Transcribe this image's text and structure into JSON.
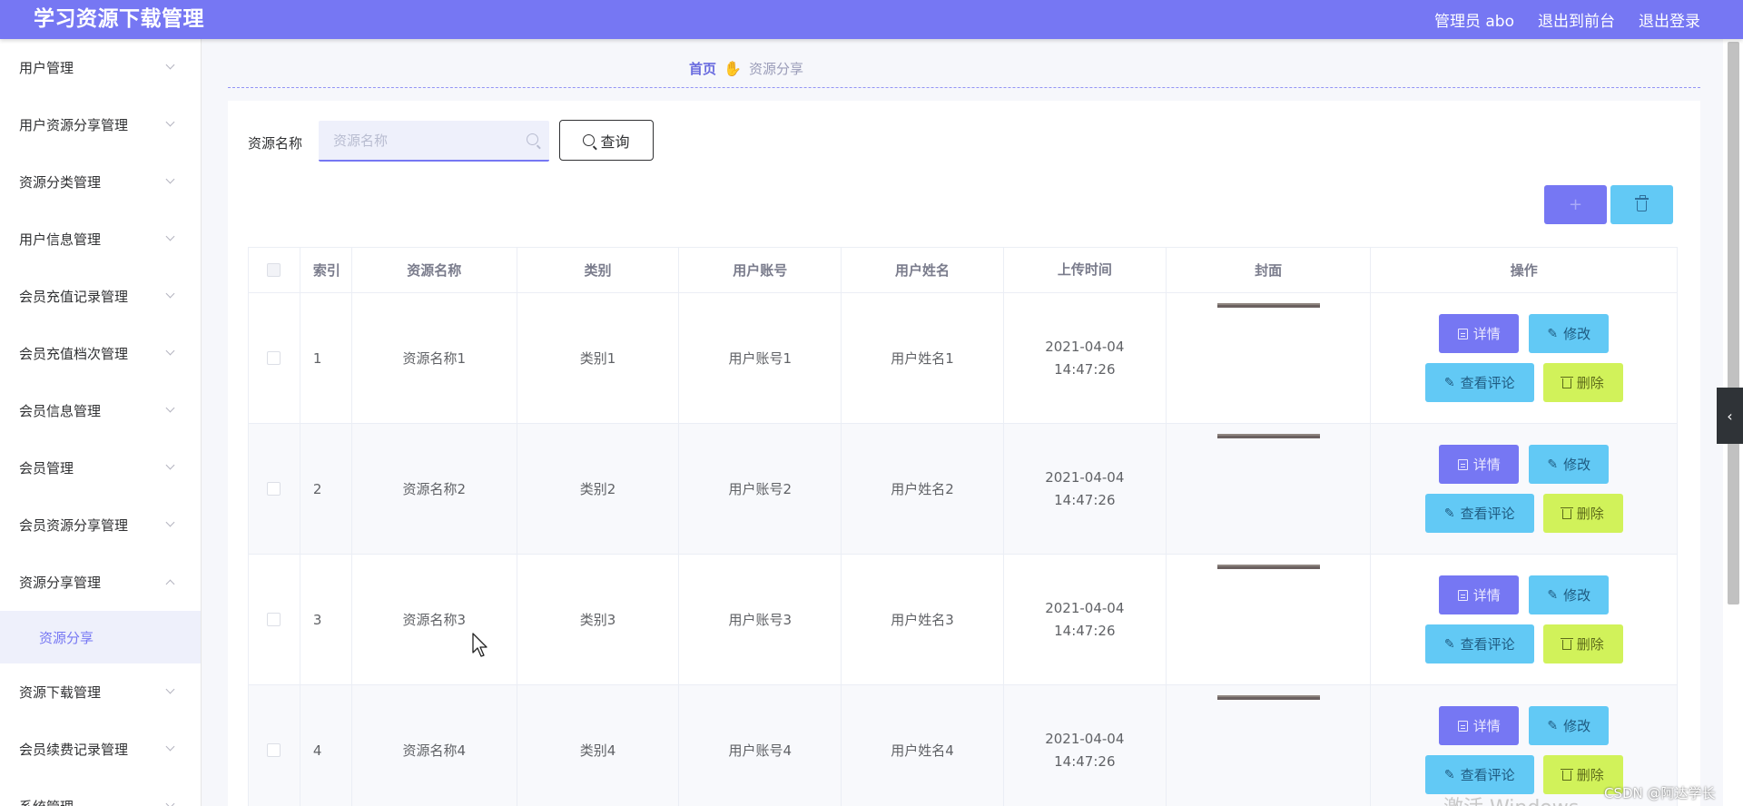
{
  "header": {
    "title": "学习资源下载管理",
    "admin": "管理员 abo",
    "to_front": "退出到前台",
    "logout": "退出登录"
  },
  "sidebar": {
    "items": [
      {
        "label": "用户管理",
        "open": false
      },
      {
        "label": "用户资源分享管理",
        "open": false
      },
      {
        "label": "资源分类管理",
        "open": false
      },
      {
        "label": "用户信息管理",
        "open": false
      },
      {
        "label": "会员充值记录管理",
        "open": false
      },
      {
        "label": "会员充值档次管理",
        "open": false
      },
      {
        "label": "会员信息管理",
        "open": false
      },
      {
        "label": "会员管理",
        "open": false
      },
      {
        "label": "会员资源分享管理",
        "open": false
      },
      {
        "label": "资源分享管理",
        "open": true
      }
    ],
    "active_sub": "资源分享",
    "items_after": [
      {
        "label": "资源下载管理"
      },
      {
        "label": "会员续费记录管理"
      },
      {
        "label": "系统管理"
      }
    ]
  },
  "breadcrumb": {
    "home": "首页",
    "current": "资源分享"
  },
  "search": {
    "label": "资源名称",
    "placeholder": "资源名称",
    "value": "",
    "button": "查询"
  },
  "toolbar": {
    "add_icon": "plus-icon",
    "delete_icon": "trash-icon"
  },
  "table": {
    "headers": [
      "索引",
      "资源名称",
      "类别",
      "用户账号",
      "用户姓名",
      "上传时间",
      "封面",
      "操作"
    ],
    "rows": [
      {
        "index": "1",
        "name": "资源名称1",
        "category": "类别1",
        "account": "用户账号1",
        "username": "用户姓名1",
        "time": "2021-04-04 14:47:26"
      },
      {
        "index": "2",
        "name": "资源名称2",
        "category": "类别2",
        "account": "用户账号2",
        "username": "用户姓名2",
        "time": "2021-04-04 14:47:26"
      },
      {
        "index": "3",
        "name": "资源名称3",
        "category": "类别3",
        "account": "用户账号3",
        "username": "用户姓名3",
        "time": "2021-04-04 14:47:26"
      },
      {
        "index": "4",
        "name": "资源名称4",
        "category": "类别4",
        "account": "用户账号4",
        "username": "用户姓名4",
        "time": "2021-04-04 14:47:26"
      }
    ],
    "actions": {
      "detail": "详情",
      "edit": "修改",
      "comment": "查看评论",
      "delete": "删除"
    }
  },
  "watermark": "CSDN @阿达学长",
  "overlay_text": "激活 Windows",
  "colors": {
    "primary": "#7677f3",
    "info": "#62c9f5",
    "warning": "#d1f25a"
  }
}
